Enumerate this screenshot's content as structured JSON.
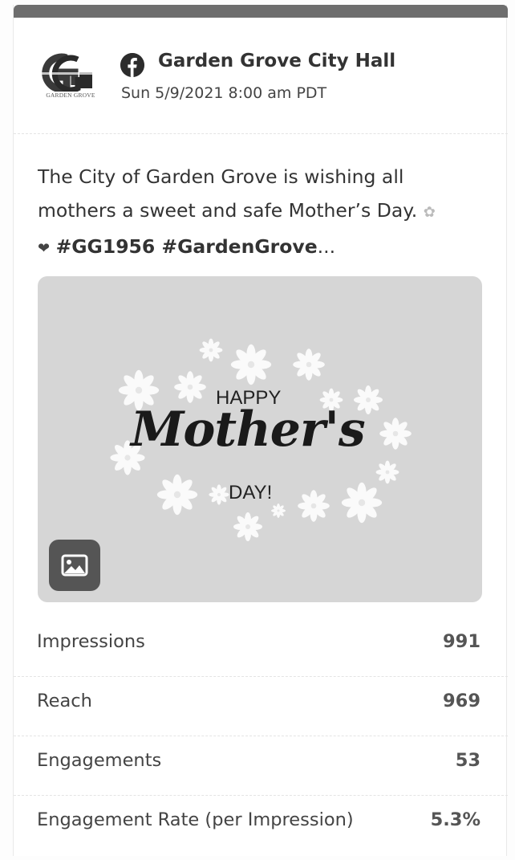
{
  "post": {
    "logo_caption": "GARDEN GROVE",
    "platform_icon": "facebook-icon",
    "account_name": "Garden Grove City Hall",
    "date": "Sun 5/9/2021 8:00 am PDT",
    "text_line1": "The City of Garden Grove is wishing all",
    "text_line2": "mothers a sweet and safe Mother’s Day.",
    "hashtags": "#GG1956 #GardenGrove",
    "ellipsis": "...",
    "image": {
      "line_top": "HAPPY",
      "line_script": "Mother's",
      "line_bottom": "DAY!",
      "type_icon": "image-icon"
    }
  },
  "metrics": [
    {
      "label": "Impressions",
      "value": "991"
    },
    {
      "label": "Reach",
      "value": "969"
    },
    {
      "label": "Engagements",
      "value": "53"
    },
    {
      "label": "Engagement Rate (per Impression)",
      "value": "5.3%"
    }
  ],
  "colors": {
    "topbar": "#6e6e6e",
    "text": "#333333",
    "image_background": "#d6d6d6",
    "badge": "#555555"
  }
}
